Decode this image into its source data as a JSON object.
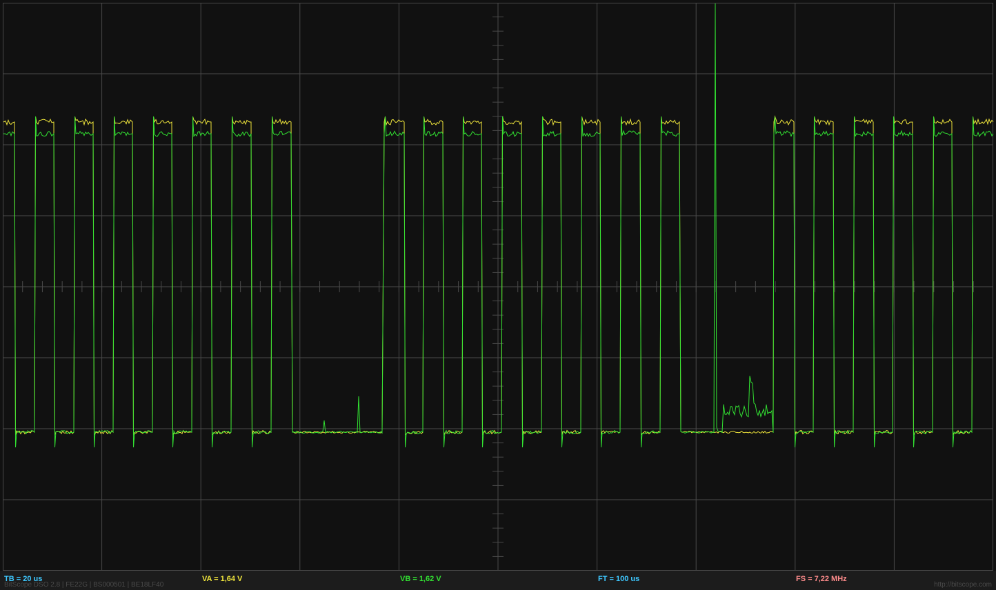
{
  "app": {
    "name": "BitScope DSO"
  },
  "display": {
    "background": "#111111",
    "grid_color": "#4a4a4a",
    "channel_a_color": "#f0e63c",
    "channel_b_color": "#32e132"
  },
  "readouts": {
    "tb": {
      "text": "TB = 20 us",
      "color": "#3ec8ff"
    },
    "va": {
      "text": "VA = 1,64 V",
      "color": "#f0e63c"
    },
    "vb": {
      "text": "VB = 1,62 V",
      "color": "#32e132"
    },
    "ft": {
      "text": "FT = 100 us",
      "color": "#3ec8ff"
    },
    "fs": {
      "text": "FS = 7,22 MHz",
      "color": "#ff8c8c"
    }
  },
  "footer": {
    "device_info": "BitScope DSO 2.8 | FE22G | BS000501 | BE18LF40",
    "url": "http://bitscope.com"
  }
}
